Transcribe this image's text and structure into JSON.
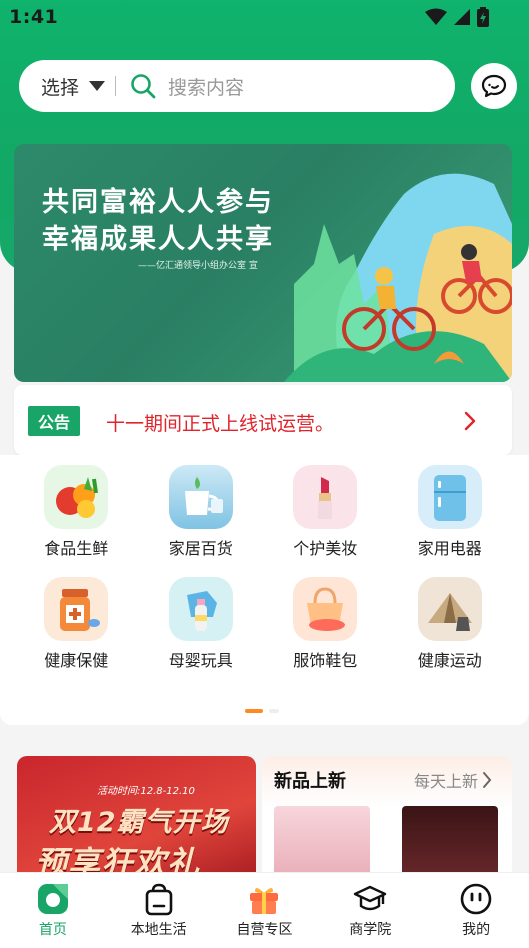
{
  "status": {
    "time": "1:41"
  },
  "search": {
    "select_label": "选择",
    "placeholder": "搜索内容"
  },
  "banner": {
    "line1": "共同富裕人人参与",
    "line2": "幸福成果人人共享",
    "subtitle": "——亿汇通领导小组办公室 宣"
  },
  "notice": {
    "tag": "公告",
    "text": "十一期间正式上线试运营。"
  },
  "categories": [
    {
      "label": "食品生鲜",
      "icon": "vegetables-icon"
    },
    {
      "label": "家居百货",
      "icon": "cup-icon"
    },
    {
      "label": "个护美妆",
      "icon": "lipstick-icon"
    },
    {
      "label": "家用电器",
      "icon": "fridge-icon"
    },
    {
      "label": "健康保健",
      "icon": "medicine-icon"
    },
    {
      "label": "母婴玩具",
      "icon": "baby-bottle-icon"
    },
    {
      "label": "服饰鞋包",
      "icon": "handbag-icon"
    },
    {
      "label": "健康运动",
      "icon": "tent-icon"
    }
  ],
  "promo": {
    "time": "活动时间:12.8-12.10",
    "line1": "双12霸气开场",
    "line2": "预享狂欢礼"
  },
  "new_arrivals": {
    "title": "新品上新",
    "more": "每天上新"
  },
  "tabs": [
    {
      "label": "首页",
      "icon": "home-icon",
      "active": true
    },
    {
      "label": "本地生活",
      "icon": "shopping-bag-icon",
      "active": false
    },
    {
      "label": "自营专区",
      "icon": "gift-icon",
      "active": false
    },
    {
      "label": "商学院",
      "icon": "graduation-cap-icon",
      "active": false
    },
    {
      "label": "我的",
      "icon": "profile-icon",
      "active": false
    }
  ],
  "colors": {
    "brand": "#18a567",
    "notice_text": "#e0242c",
    "accent_dot": "#ff8a1f"
  }
}
